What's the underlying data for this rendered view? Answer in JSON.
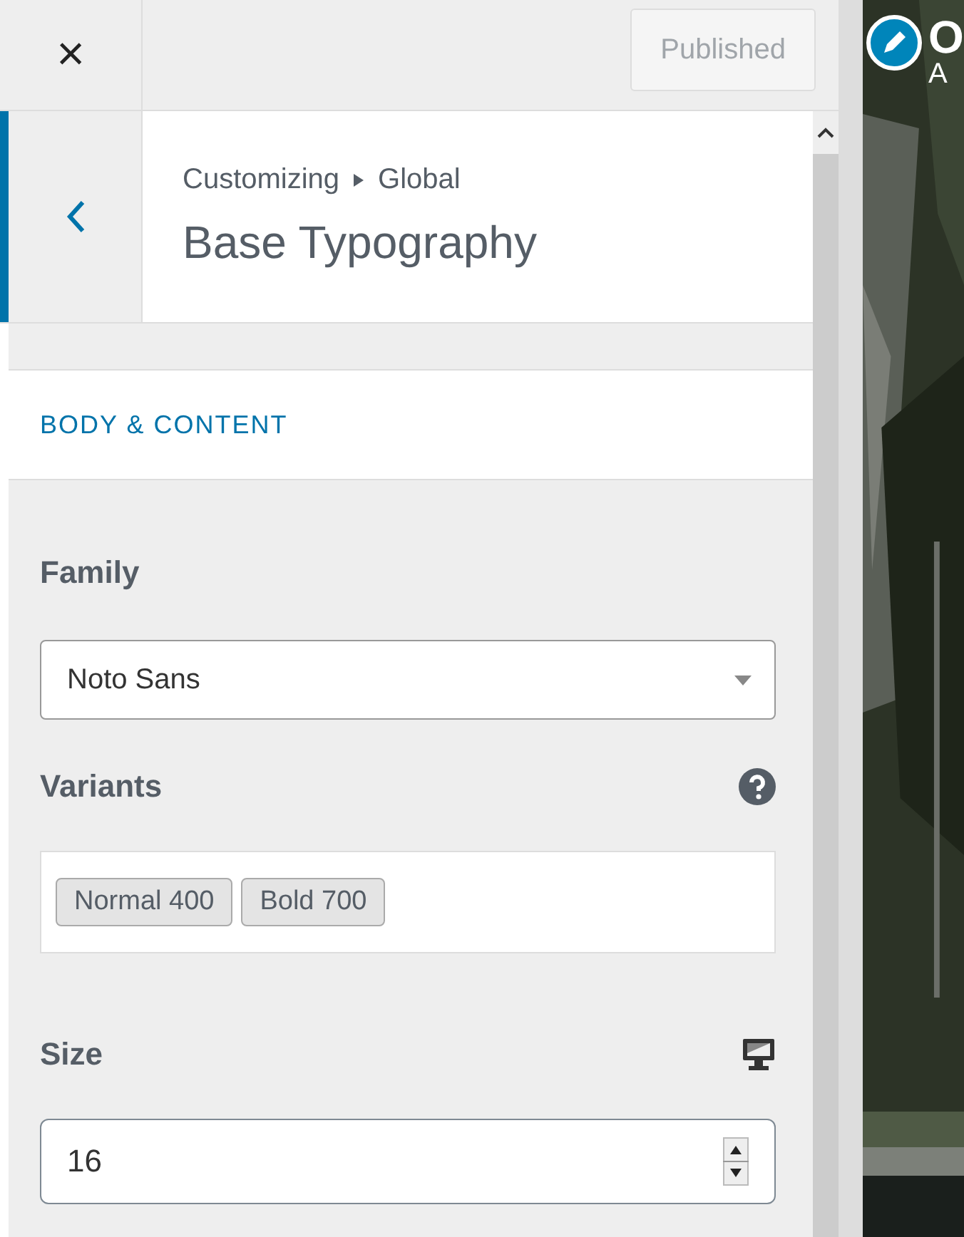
{
  "header": {
    "close": "×",
    "publish": {
      "label": "Published",
      "disabled": true
    }
  },
  "section": {
    "breadcrumb": [
      "Customizing",
      "Global"
    ],
    "title": "Base Typography"
  },
  "group": {
    "title": "BODY & CONTENT"
  },
  "family": {
    "label": "Family",
    "value": "Noto Sans"
  },
  "variants": {
    "label": "Variants",
    "tags": [
      "Normal 400",
      "Bold 700"
    ]
  },
  "size": {
    "label": "Size",
    "value": "16"
  },
  "preview": {
    "site_title": "O",
    "site_tagline": "A"
  }
}
